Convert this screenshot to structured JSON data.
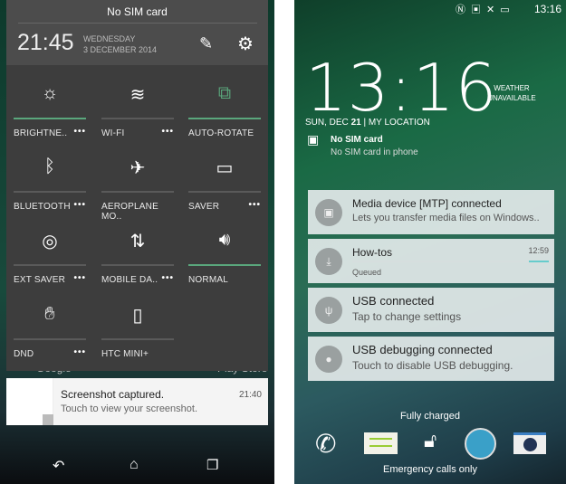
{
  "left_phone": {
    "header": {
      "carrier": "No SIM card",
      "time": "21:45",
      "day": "WEDNESDAY",
      "date": "3 DECEMBER 2014",
      "edit_icon": "edit-icon",
      "settings_icon": "gear-icon"
    },
    "tiles": [
      {
        "label": "BRIGHTNE..",
        "icon": "brightness-auto-icon",
        "more": "•••",
        "active": true
      },
      {
        "label": "WI-FI",
        "icon": "wifi-icon",
        "more": "•••",
        "active": false
      },
      {
        "label": "AUTO-ROTATE",
        "icon": "auto-rotate-icon",
        "more": "",
        "active": true
      },
      {
        "label": "BLUETOOTH",
        "icon": "bluetooth-icon",
        "more": "•••",
        "active": false
      },
      {
        "label": "AEROPLANE MO..",
        "icon": "airplane-icon",
        "more": "",
        "active": false
      },
      {
        "label": "SAVER",
        "icon": "power-saver-icon",
        "more": "•••",
        "active": false
      },
      {
        "label": "EXT SAVER",
        "icon": "extreme-saver-icon",
        "more": "•••",
        "active": false
      },
      {
        "label": "MOBILE DA..",
        "icon": "mobile-data-icon",
        "more": "•••",
        "active": false
      },
      {
        "label": "NORMAL",
        "icon": "volume-icon",
        "more": "",
        "active": true
      },
      {
        "label": "DND",
        "icon": "do-not-disturb-icon",
        "more": "•••",
        "active": false
      },
      {
        "label": "HTC MINI+",
        "icon": "htc-mini-icon",
        "more": "",
        "active": false
      }
    ],
    "background_labels": {
      "google": "Google",
      "play_store": "Play Store"
    },
    "notification": {
      "title": "Screenshot captured.",
      "time": "21:40",
      "text": "Touch to view your screenshot."
    },
    "nav": {
      "back": "back-icon",
      "home": "home-icon",
      "recents": "recents-icon"
    }
  },
  "right_phone": {
    "status": {
      "time": "13:16",
      "icons": [
        "nfc-icon",
        "no-sim-icon",
        "signal-icon",
        "battery-icon"
      ]
    },
    "clock": "13:16",
    "weather": "WEATHER UNAVAILABLE",
    "date_prefix": "SUN, DEC ",
    "date_day": "21",
    "location": "MY LOCATION",
    "sim": {
      "title": "No SIM card",
      "text": "No SIM card in phone"
    },
    "notifications": [
      {
        "title": "Media device [MTP] connected",
        "text": "Lets you transfer media files on Windows..",
        "time": "",
        "icon": "media-device-icon"
      },
      {
        "title": "How-tos",
        "text": "Queued",
        "time": "12:59",
        "icon": "download-icon",
        "progress": 0.1
      },
      {
        "title": "USB connected",
        "text": "Tap to change settings",
        "time": "",
        "icon": "usb-icon"
      },
      {
        "title": "USB debugging connected",
        "text": "Touch to disable USB debugging.",
        "time": "",
        "icon": "android-debug-icon"
      }
    ],
    "charge_status": "Fully charged",
    "dock": [
      "phone-icon",
      "messages-icon",
      "unlock-icon",
      "browser-icon",
      "camera-icon"
    ],
    "emergency": "Emergency calls only",
    "accent": "#5aa77c"
  }
}
